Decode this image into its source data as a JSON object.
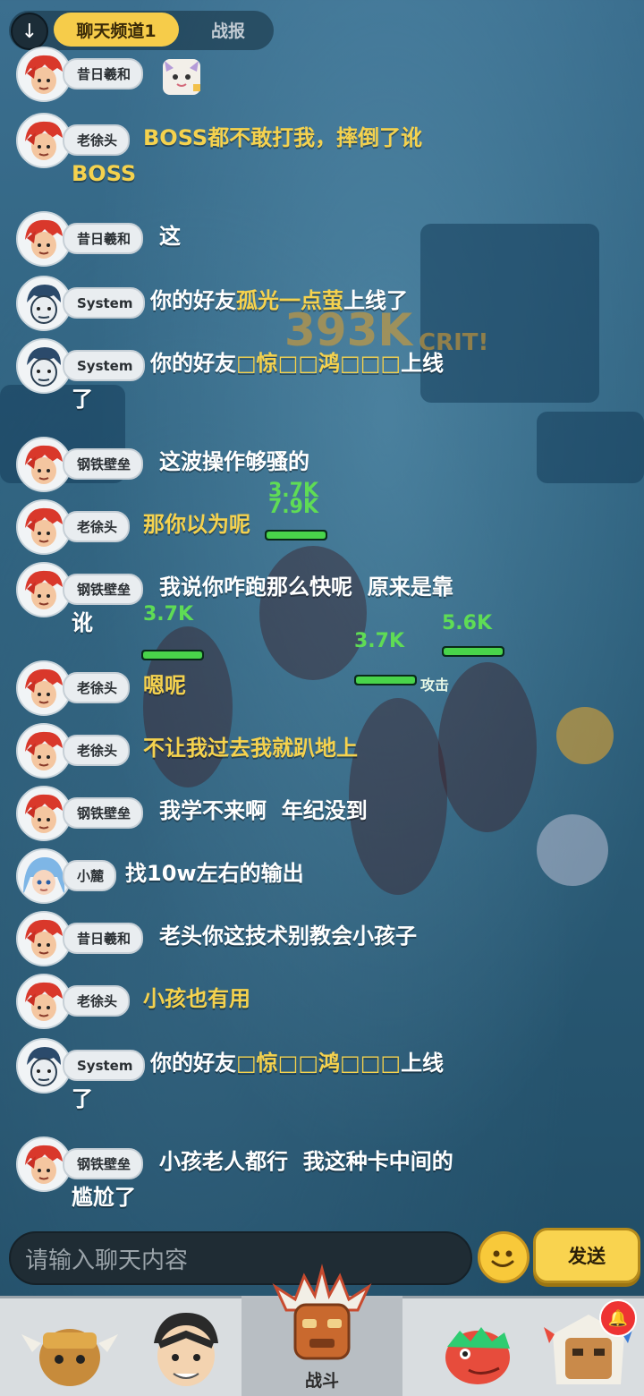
{
  "header": {
    "scroll_icon": "arrow-down-icon",
    "tabs": [
      {
        "label": "聊天频道1",
        "active": true
      },
      {
        "label": "战报",
        "active": false
      }
    ]
  },
  "battle_overlay": {
    "big_damage": "393K",
    "crit_label": "CRIT!",
    "damage_numbers": [
      "3.7K",
      "7.9K",
      "3.7K",
      "3.7K",
      "5.6K"
    ],
    "attack_label": "攻击"
  },
  "messages": [
    {
      "name": "昔日羲和",
      "avatar": "red-hair-avatar",
      "sticker": true
    },
    {
      "name": "老徐头",
      "avatar": "red-hair-avatar",
      "lines": [
        "BOSS都不敢打我，摔倒了讹",
        "BOSS"
      ],
      "highlight": true
    },
    {
      "name": "昔日羲和",
      "avatar": "red-hair-avatar",
      "lines": [
        "这"
      ]
    },
    {
      "name": "System",
      "avatar": "system-avatar",
      "pre": "你的好友",
      "friend": "孤光一点萤",
      "post": "上线了"
    },
    {
      "name": "System",
      "avatar": "system-avatar",
      "pre": "你的好友",
      "friend": "□惊□□鸿□□□",
      "post": "上线",
      "line2": "了"
    },
    {
      "name": "钢铁壁垒",
      "avatar": "red-hair-avatar",
      "lines": [
        "这波操作够骚的"
      ]
    },
    {
      "name": "老徐头",
      "avatar": "red-hair-avatar",
      "lines": [
        "那你以为呢"
      ],
      "highlight": true
    },
    {
      "name": "钢铁壁垒",
      "avatar": "red-hair-avatar",
      "lines": [
        "我说你咋跑那么快呢  原来是靠",
        "讹"
      ]
    },
    {
      "name": "老徐头",
      "avatar": "red-hair-avatar",
      "lines": [
        "嗯呢"
      ],
      "highlight": true
    },
    {
      "name": "老徐头",
      "avatar": "red-hair-avatar",
      "lines": [
        "不让我过去我就趴地上"
      ],
      "highlight": true
    },
    {
      "name": "钢铁壁垒",
      "avatar": "red-hair-avatar",
      "lines": [
        "我学不来啊  年纪没到"
      ]
    },
    {
      "name": "小麓",
      "avatar": "blue-hair-avatar",
      "lines": [
        "找10w左右的输出"
      ]
    },
    {
      "name": "昔日羲和",
      "avatar": "red-hair-avatar",
      "lines": [
        "老头你这技术别教会小孩子"
      ]
    },
    {
      "name": "老徐头",
      "avatar": "red-hair-avatar",
      "lines": [
        "小孩也有用"
      ],
      "highlight": true
    },
    {
      "name": "System",
      "avatar": "system-avatar",
      "pre": "你的好友",
      "friend": "□惊□□鸿□□□",
      "post": "上线",
      "line2": "了"
    },
    {
      "name": "钢铁壁垒",
      "avatar": "red-hair-avatar",
      "lines": [
        "小孩老人都行  我这种卡中间的",
        "尴尬了"
      ]
    }
  ],
  "composer": {
    "placeholder": "请输入聊天内容",
    "emoji_icon": "smiley-icon",
    "send_label": "发送"
  },
  "bottom_nav": {
    "items": [
      {
        "icon": "horned-hero-icon"
      },
      {
        "icon": "hero-portrait-icon"
      },
      {
        "icon": "battle-mask-icon",
        "label": "战斗",
        "active": true
      },
      {
        "icon": "dinosaur-icon"
      },
      {
        "icon": "guild-totem-icon",
        "notification": "🔔"
      }
    ]
  }
}
